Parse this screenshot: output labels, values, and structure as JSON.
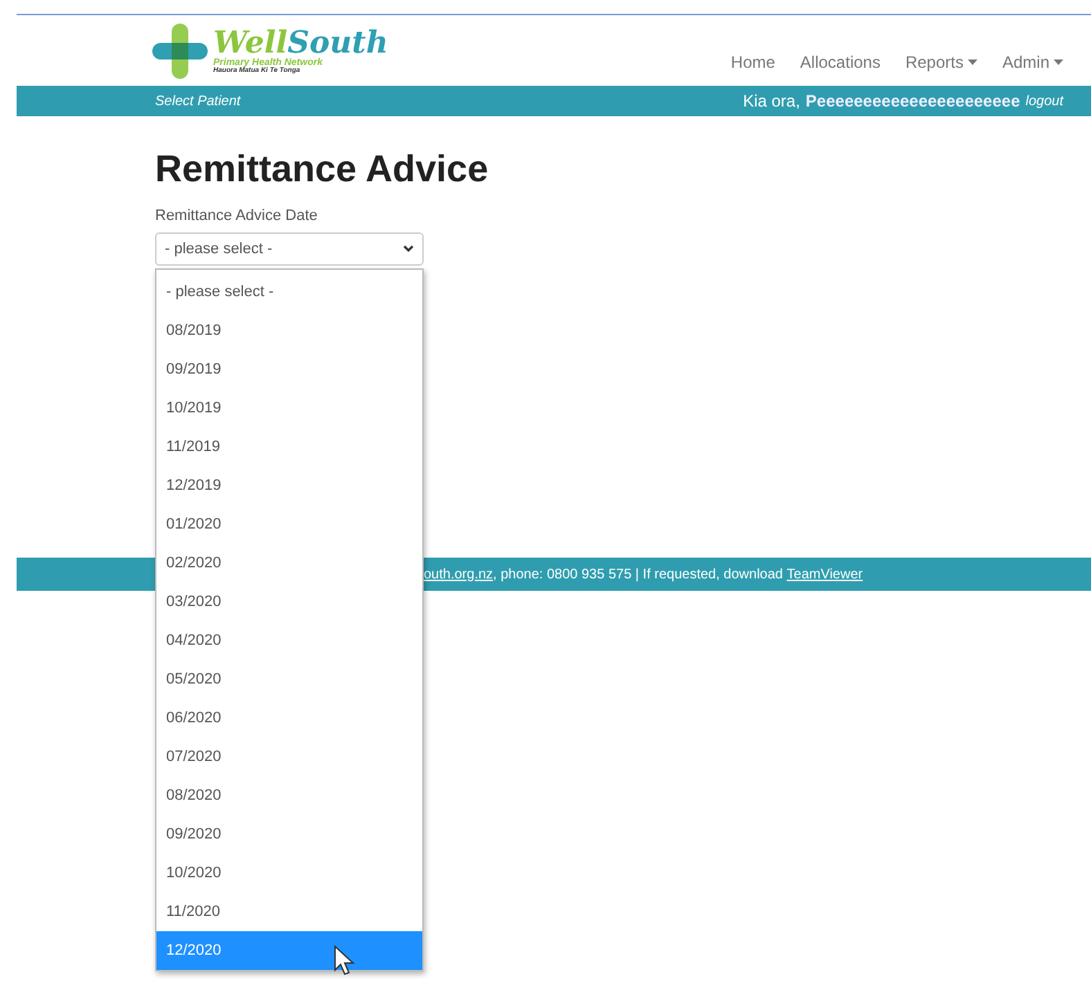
{
  "logo": {
    "name_first": "Well",
    "name_second": "South",
    "subtitle": "Primary Health Network",
    "tagline": "Hauora Matua Ki Te Tonga"
  },
  "nav": [
    {
      "label": "Home",
      "dropdown": false
    },
    {
      "label": "Allocations",
      "dropdown": false
    },
    {
      "label": "Reports",
      "dropdown": true
    },
    {
      "label": "Admin",
      "dropdown": true
    }
  ],
  "sub_bar": {
    "left_link": "Select Patient",
    "greeting": "Kia ora,",
    "user": "Peeeeeeeeeeeeeeeeeeeeee",
    "logout": "logout"
  },
  "page": {
    "title": "Remittance Advice",
    "field_label": "Remittance Advice Date",
    "select_value": "- please select -"
  },
  "dropdown_options": [
    {
      "label": "- please select -",
      "selected": false
    },
    {
      "label": "08/2019",
      "selected": false
    },
    {
      "label": "09/2019",
      "selected": false
    },
    {
      "label": "10/2019",
      "selected": false
    },
    {
      "label": "11/2019",
      "selected": false
    },
    {
      "label": "12/2019",
      "selected": false
    },
    {
      "label": "01/2020",
      "selected": false
    },
    {
      "label": "02/2020",
      "selected": false
    },
    {
      "label": "03/2020",
      "selected": false
    },
    {
      "label": "04/2020",
      "selected": false
    },
    {
      "label": "05/2020",
      "selected": false
    },
    {
      "label": "06/2020",
      "selected": false
    },
    {
      "label": "07/2020",
      "selected": false
    },
    {
      "label": "08/2020",
      "selected": false
    },
    {
      "label": "09/2020",
      "selected": false
    },
    {
      "label": "10/2020",
      "selected": false
    },
    {
      "label": "11/2020",
      "selected": false
    },
    {
      "label": "12/2020",
      "selected": true
    }
  ],
  "footer": {
    "email_link": "outh.org.nz",
    "text": ", phone: 0800 935 575 | If requested, download ",
    "download_link": "TeamViewer"
  }
}
